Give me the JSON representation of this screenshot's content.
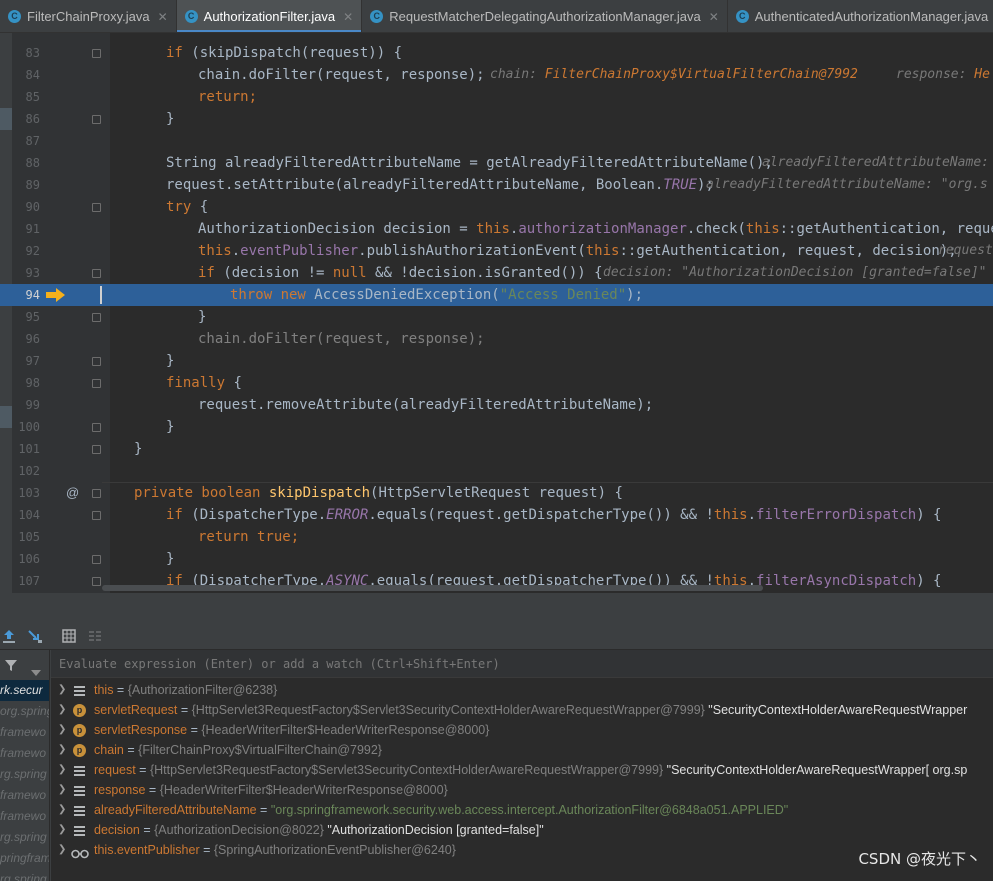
{
  "tabs": [
    {
      "label": "FilterChainProxy.java",
      "active": false
    },
    {
      "label": "AuthorizationFilter.java",
      "active": true
    },
    {
      "label": "RequestMatcherDelegatingAuthorizationManager.java",
      "active": false
    },
    {
      "label": "AuthenticatedAuthorizationManager.java",
      "active": false
    }
  ],
  "tab_icon_letter": "C",
  "tab_close_glyph": "✕",
  "editor": {
    "line_numbers": [
      "83",
      "84",
      "85",
      "86",
      "87",
      "88",
      "89",
      "90",
      "91",
      "92",
      "93",
      "94",
      "95",
      "96",
      "97",
      "98",
      "99",
      "100",
      "101",
      "102",
      "103",
      "104",
      "105",
      "106",
      "107"
    ],
    "execution_line": "94",
    "at_marker": "@",
    "lines": {
      "l83": {
        "a": "if",
        "b": " (skipDispatch(request)) {"
      },
      "l84": {
        "a": "chain.doFilter(request, response);",
        "h1": "chain: ",
        "v1": "FilterChainProxy$VirtualFilterChain@7992",
        "h2": "response: ",
        "v2": "He"
      },
      "l85": {
        "a": "return;"
      },
      "l86": {
        "a": "}"
      },
      "l88": {
        "a": "String alreadyFilteredAttributeName = getAlreadyFilteredAttributeName();",
        "h1": "alreadyFilteredAttributeName:"
      },
      "l89": {
        "a": "request.setAttribute(alreadyFilteredAttributeName, Boolean.",
        "b": "TRUE",
        "c": ");",
        "h1": "alreadyFilteredAttributeName: \"org.s"
      },
      "l90": {
        "a": "try",
        "b": " {"
      },
      "l91": {
        "a": "AuthorizationDecision decision = ",
        "b": "this",
        "c": ".",
        "d": "authorizationManager",
        "e": ".check(",
        "f": "this",
        "g": "::getAuthentication, request);"
      },
      "l92": {
        "a": "this",
        "b": ".",
        "c": "eventPublisher",
        "d": ".publishAuthorizationEvent(",
        "e": "this",
        "f": "::getAuthentication, request, decision);",
        "h1": "request"
      },
      "l93": {
        "a": "if",
        "b": " (decision != ",
        "c": "null",
        "d": " && !decision.isGranted()) {",
        "h1": "decision: \"AuthorizationDecision [granted=false]\""
      },
      "l94": {
        "a": "throw new",
        "b": " AccessDeniedException(",
        "c": "\"Access Denied\"",
        "d": ");"
      },
      "l95": {
        "a": "}"
      },
      "l96": {
        "a": "chain.doFilter(request, response);"
      },
      "l97": {
        "a": "}"
      },
      "l98": {
        "a": "finally",
        "b": " {"
      },
      "l99": {
        "a": "request.removeAttribute(alreadyFilteredAttributeName);"
      },
      "l100": {
        "a": "}"
      },
      "l101": {
        "a": "}"
      },
      "l103": {
        "a": "private boolean",
        "b": " skipDispatch",
        "c": "(HttpServletRequest request) {"
      },
      "l104": {
        "a": "if",
        "b": " (DispatcherType.",
        "c": "ERROR",
        "d": ".equals(request.getDispatcherType()) && !",
        "e": "this",
        "f": ".",
        "g": "filterErrorDispatch",
        "h": ") {"
      },
      "l105": {
        "a": "return true;"
      },
      "l106": {
        "a": "}"
      },
      "l107": {
        "a": "if",
        "b": " (DispatcherType.",
        "c": "ASYNC",
        "d": ".equals(request.getDispatcherType()) && !",
        "e": "this",
        "f": ".",
        "g": "filterAsyncDispatch",
        "h": ") {"
      }
    }
  },
  "debug": {
    "eval_placeholder": "Evaluate expression (Enter) or add a watch (Ctrl+Shift+Enter)",
    "frames": [
      {
        "label": "rk.secur",
        "selected": true
      },
      {
        "label": "org.spring",
        "selected": false
      },
      {
        "label": "framewo",
        "selected": false
      },
      {
        "label": "framewo",
        "selected": false
      },
      {
        "label": "rg.spring",
        "selected": false
      },
      {
        "label": "framewo",
        "selected": false
      },
      {
        "label": "framewo",
        "selected": false
      },
      {
        "label": "rg.spring",
        "selected": false
      },
      {
        "label": "pringfram",
        "selected": false
      },
      {
        "label": "rg.spring",
        "selected": false
      }
    ],
    "variables": [
      {
        "icon": "field",
        "name": "this",
        "eq": " = ",
        "ref": "{AuthorizationFilter@6238}",
        "val": "",
        "str": ""
      },
      {
        "icon": "p",
        "name": "servletRequest",
        "eq": " = ",
        "ref": "{HttpServlet3RequestFactory$Servlet3SecurityContextHolderAwareRequestWrapper@7999}",
        "val": " \"SecurityContextHolderAwareRequestWrapper",
        "str": ""
      },
      {
        "icon": "p",
        "name": "servletResponse",
        "eq": " = ",
        "ref": "{HeaderWriterFilter$HeaderWriterResponse@8000}",
        "val": "",
        "str": ""
      },
      {
        "icon": "p",
        "name": "chain",
        "eq": " = ",
        "ref": "{FilterChainProxy$VirtualFilterChain@7992}",
        "val": "",
        "str": ""
      },
      {
        "icon": "field",
        "name": "request",
        "eq": " = ",
        "ref": "{HttpServlet3RequestFactory$Servlet3SecurityContextHolderAwareRequestWrapper@7999}",
        "val": " \"SecurityContextHolderAwareRequestWrapper[ org.sp",
        "str": ""
      },
      {
        "icon": "field",
        "name": "response",
        "eq": " = ",
        "ref": "{HeaderWriterFilter$HeaderWriterResponse@8000}",
        "val": "",
        "str": ""
      },
      {
        "icon": "field",
        "name": "alreadyFilteredAttributeName",
        "eq": " = ",
        "ref": "",
        "val": "",
        "str": "\"org.springframework.security.web.access.intercept.AuthorizationFilter@6848a051.APPLIED\""
      },
      {
        "icon": "field",
        "name": "decision",
        "eq": " = ",
        "ref": "{AuthorizationDecision@8022}",
        "val": " \"AuthorizationDecision [granted=false]\"",
        "str": ""
      },
      {
        "icon": "glasses",
        "name": "this.eventPublisher",
        "eq": " = ",
        "ref": "{SpringAuthorizationEventPublisher@6240}",
        "val": "",
        "str": ""
      }
    ]
  },
  "watermark": "CSDN @夜光下丶"
}
